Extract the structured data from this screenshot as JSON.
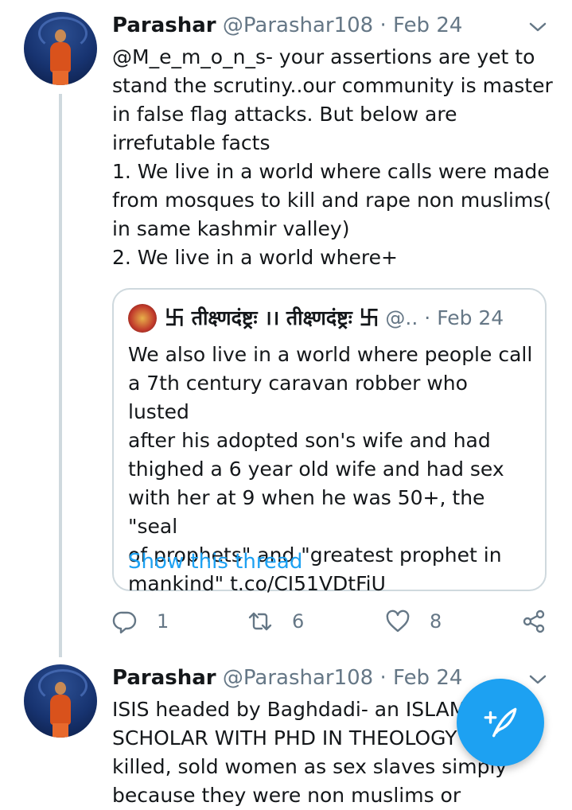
{
  "tweets": [
    {
      "name": "Parashar",
      "handle": "@Parashar108",
      "sep": "·",
      "date": "Feb 24",
      "text": "@M_e_m_o_n_s- your assertions are yet to\nstand the scrutiny..our community is master\nin false flag attacks. But below are\nirrefutable facts\n1. We live in a world where calls were made\nfrom mosques to kill and rape non muslims(\nin same kashmir valley)\n2. We live in a world where+",
      "quote": {
        "name": "卐 तीक्ष्णदंष्ट्रः ।। तीक्ष्णदंष्ट्रः 卐",
        "handle": "@..",
        "sep": "·",
        "date": "Feb 24",
        "text": "We also live in a world where people call\na 7th century caravan robber who lusted\nafter his adopted son's wife and had\nthighed a 6 year old wife and had sex\nwith her at 9 when he was 50+, the \"seal\nof prophets\" and \"greatest prophet in\nmankind\" t.co/CI51VDtFiU",
        "link": "Show this thread"
      },
      "actions": {
        "replies": "1",
        "retweets": "6",
        "likes": "8"
      }
    },
    {
      "name": "Parashar",
      "handle": "@Parashar108",
      "sep": "·",
      "date": "Feb 24",
      "text": "ISIS headed by Baghdadi- an ISLAMIC\nSCHOLAR WITH PHD IN THEOLOGY\nkilled, sold women as sex slaves simply\nbecause they were non muslims or"
    }
  ],
  "colors": {
    "accent": "#1da1f2",
    "muted": "#657786",
    "border": "#cfd9de"
  },
  "icons": [
    "reply-icon",
    "retweet-icon",
    "like-icon",
    "share-icon",
    "chevron-down-icon",
    "compose-icon"
  ]
}
